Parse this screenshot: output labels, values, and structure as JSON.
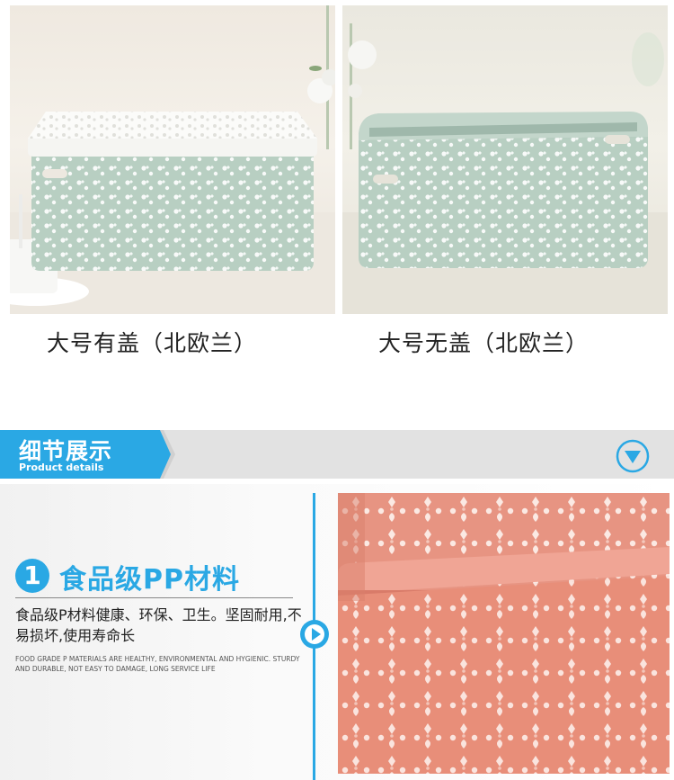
{
  "top_products": [
    {
      "caption": "大号有盖（北欧兰）",
      "image": "basket-with-lid-photo"
    },
    {
      "caption": "大号无盖（北欧兰）",
      "image": "basket-without-lid-photo"
    }
  ],
  "section_banner": {
    "title": "细节展示",
    "subtitle": "Product details",
    "icon": "chevron-down-circle-icon"
  },
  "feature": {
    "number": "1",
    "title": "食品级PP材料",
    "description": "食品级P材料健康、环保、卫生。坚固耐用,不易损坏,使用寿命长",
    "english": "FOOD GRADE P MATERIALS ARE HEALTHY, ENVIRONMENTAL AND HYGIENIC. STURDY AND DURABLE, NOT EASY TO DAMAGE, LONG SERVICE LIFE",
    "arrow_icon": "play-circle-icon",
    "image": "pink-basket-closeup-photo"
  },
  "colors": {
    "accent": "#2aa8e4",
    "basket_green": "#b8cfc2",
    "basket_pink": "#e88e79",
    "banner_gray": "#e2e2e2"
  }
}
